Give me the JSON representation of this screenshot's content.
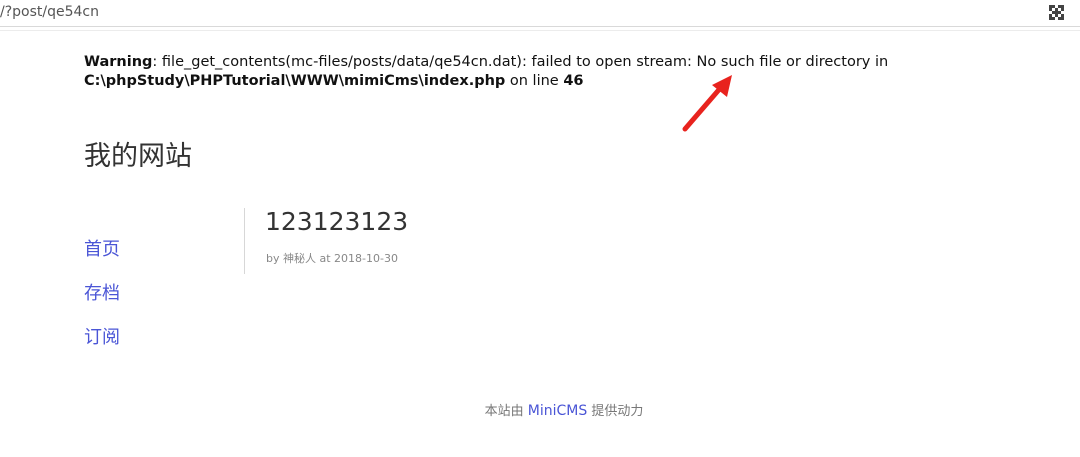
{
  "address_bar": {
    "url": "/?post/qe54cn"
  },
  "warning": {
    "label": "Warning",
    "message": ": file_get_contents(mc-files/posts/data/qe54cn.dat): failed to open stream: No such file or directory in ",
    "path": "C:\\phpStudy\\PHPTutorial\\WWW\\mimiCms\\index.php",
    "line_prefix": " on line ",
    "line_number": "46"
  },
  "site": {
    "title": "我的网站"
  },
  "nav": {
    "items": [
      {
        "label": "首页"
      },
      {
        "label": "存档"
      },
      {
        "label": "订阅"
      }
    ]
  },
  "post": {
    "title": "123123123",
    "meta": "by 神秘人 at 2018-10-30"
  },
  "footer": {
    "prefix": "本站由 ",
    "link": "MiniCMS",
    "suffix": " 提供动力"
  },
  "colors": {
    "link": "#4a55d6",
    "annotation_arrow": "#e8231e"
  },
  "icons": {
    "qr": "qr-code-icon",
    "arrow": "annotation-arrow-icon"
  }
}
